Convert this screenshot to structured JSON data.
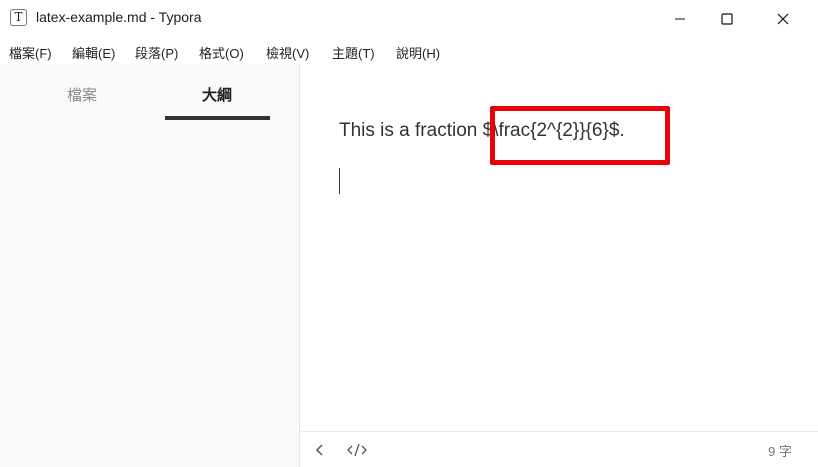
{
  "window": {
    "app_icon_letter": "T",
    "title": "latex-example.md - Typora"
  },
  "menu": {
    "items": [
      "檔案(F)",
      "編輯(E)",
      "段落(P)",
      "格式(O)",
      "檢視(V)",
      "主題(T)",
      "說明(H)"
    ]
  },
  "sidebar": {
    "tabs": [
      {
        "label": "檔案",
        "active": false
      },
      {
        "label": "大綱",
        "active": true
      }
    ]
  },
  "editor": {
    "paragraph_text": "This is a fraction ",
    "latex_source": "$\\frac{2^{2}}{6}$."
  },
  "statusbar": {
    "word_count": "9 字"
  },
  "colors": {
    "highlight_box": "#e8000b",
    "sidebar_bg": "#fafafa",
    "text": "#333333"
  },
  "icons": [
    "window-minimize-icon",
    "window-maximize-icon",
    "window-close-icon",
    "chevron-left-icon",
    "code-source-icon"
  ]
}
